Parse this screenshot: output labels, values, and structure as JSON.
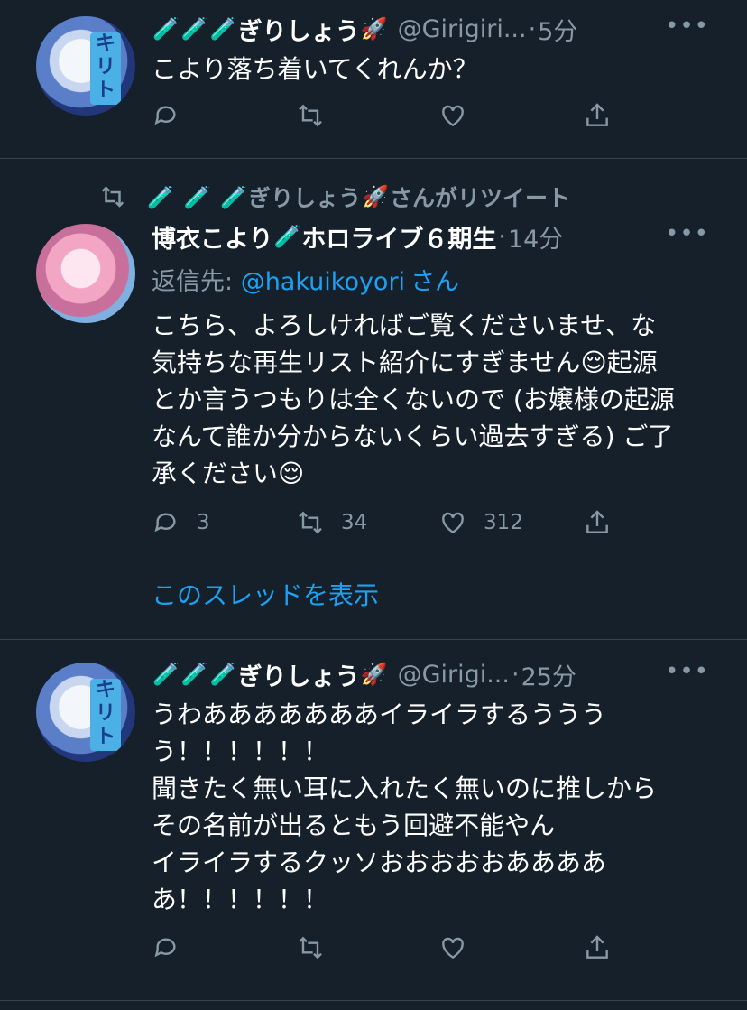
{
  "tweets": [
    {
      "name": "ぎりしょう",
      "handle": "@Girigiri...",
      "dot": "·",
      "time": "5分",
      "more": "•••",
      "avatar_tag": "キリト",
      "text": "こより落ち着いてくれんか？",
      "actions": {
        "replies": "",
        "retweets": "",
        "likes": ""
      }
    },
    {
      "retweeted_by_name": "ぎりしょう",
      "retweeted_suffix": "さんがリツイート",
      "name": "博衣こより",
      "name_suffix": "ホロライブ６期生",
      "dot": "·",
      "time": "14分",
      "more": "•••",
      "reply_prefix": "返信先: ",
      "reply_handle": "@hakuikoyori",
      "reply_suffix": "さん",
      "text": "こちら、よろしければご覧くださいませ、な\n気持ちな再生リスト紹介にすぎません😌起源\nとか言うつもりは全くないので (お嬢様の起源\nなんて誰か分からないくらい過去すぎる) ご了\n承ください😌",
      "actions": {
        "replies": "3",
        "retweets": "34",
        "likes": "312"
      },
      "thread_link": "このスレッドを表示"
    },
    {
      "name": "ぎりしょう",
      "handle": "@Girigi...",
      "dot": "·",
      "time": "25分",
      "more": "•••",
      "avatar_tag": "キリト",
      "text": "うわあああああああイライラするううう\nう！！！！！！\n聞きたく無い耳に入れたく無いのに推しから\nその名前が出るともう回避不能やん\nイライラするクッソおおおおおああああ\nあ！！！！！！",
      "actions": {
        "replies": "",
        "retweets": "",
        "likes": ""
      }
    }
  ],
  "icons": {
    "tube": "test-tube-emoji",
    "rocket": "rocket-emoji",
    "reply": "reply-icon",
    "retweet": "retweet-icon",
    "like": "heart-icon",
    "share": "share-icon"
  },
  "colors": {
    "background": "#15202b",
    "secondary_text": "#8899a6",
    "link": "#1da1f2",
    "divider": "#38444d"
  }
}
